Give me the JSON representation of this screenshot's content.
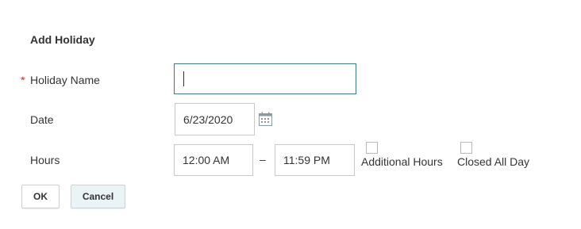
{
  "dialog": {
    "title": "Add Holiday"
  },
  "form": {
    "holiday_name": {
      "required_marker": "*",
      "label": "Holiday Name",
      "value": ""
    },
    "date": {
      "label": "Date",
      "value": "6/23/2020",
      "icon": "calendar-icon"
    },
    "hours": {
      "label": "Hours",
      "start_value": "12:00 AM",
      "separator": "–",
      "end_value": "11:59 PM"
    },
    "additional_hours": {
      "label": "Additional Hours",
      "checked": false
    },
    "closed_all_day": {
      "label": "Closed All Day",
      "checked": false
    }
  },
  "buttons": {
    "ok_label": "OK",
    "cancel_label": "Cancel"
  },
  "colors": {
    "required": "#d9272e",
    "focus_border": "#3f7a89",
    "cancel_bg": "#eaf3f6"
  }
}
